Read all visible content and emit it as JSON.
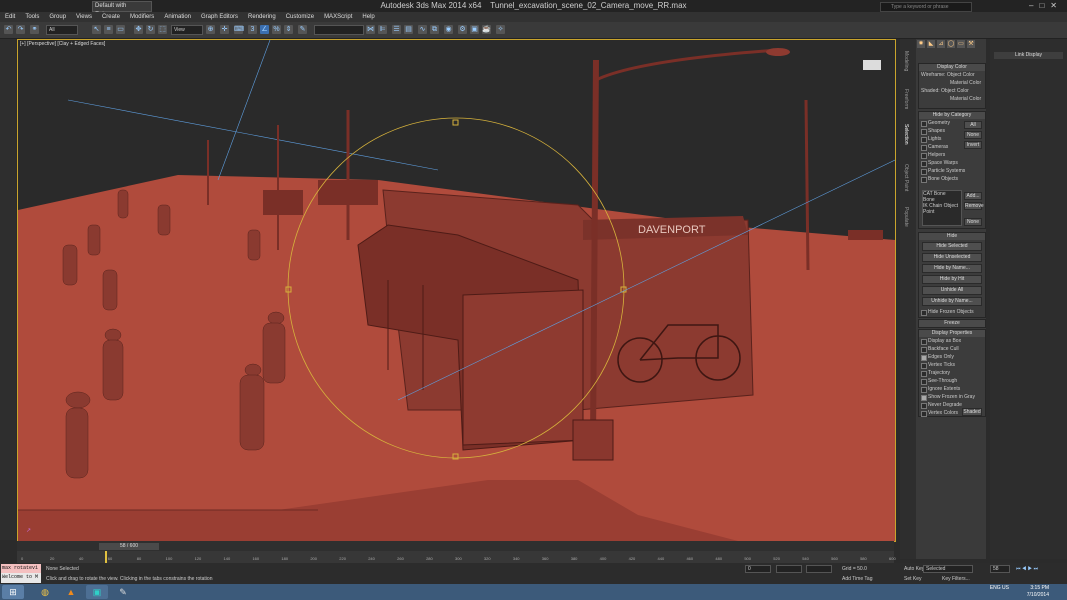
{
  "titlebar": {
    "app": "Autodesk 3ds Max  2014 x64",
    "file": "Tunnel_excavation_scene_02_Camera_move_RR.max",
    "workspace": "Default with Enhance",
    "search_placeholder": "Type a keyword or phrase"
  },
  "menu": [
    "Edit",
    "Tools",
    "Group",
    "Views",
    "Create",
    "Modifiers",
    "Animation",
    "Graph Editors",
    "Rendering",
    "Customize",
    "MAXScript",
    "Help"
  ],
  "toolbar": {
    "filter": "All",
    "refcoord": "View"
  },
  "viewport": {
    "label": "[+] [Perspective] [Clay + Edged Faces]",
    "sign": "DAVENPORT"
  },
  "cmdtabs": [
    "Modeling",
    "Freeform",
    "Selection",
    "Object Paint",
    "Populate"
  ],
  "cmdpanel": {
    "display_color": {
      "title": "Display Color",
      "wireframe_label": "Wireframe:",
      "shaded_label": "Shaded:",
      "object_color": "Object Color",
      "material_color": "Material Color"
    },
    "hide_by_category": {
      "title": "Hide by Category",
      "items": [
        "Geometry",
        "Shapes",
        "Lights",
        "Cameras",
        "Helpers",
        "Space Warps",
        "Particle Systems",
        "Bone Objects"
      ],
      "buttons": [
        "All",
        "None",
        "Invert"
      ],
      "list": [
        "CAT Bone",
        "Bone",
        "IK Chain Object",
        "Point"
      ],
      "list_buttons": [
        "Add...",
        "Remove",
        "None"
      ]
    },
    "hide": {
      "title": "Hide",
      "buttons": [
        "Hide Selected",
        "Hide Unselected",
        "Hide by Name...",
        "Hide by Hit",
        "Unhide All",
        "Unhide by Name..."
      ],
      "frozen": "Hide Frozen Objects"
    },
    "freeze": {
      "title": "Freeze"
    },
    "display_properties": {
      "title": "Display Properties",
      "items": [
        "Display as Box",
        "Backface Cull",
        "Edges Only",
        "Vertex Ticks",
        "Trajectory",
        "See-Through",
        "Ignore Extents",
        "Show Frozen in Gray",
        "Never Degrade",
        "Vertex Colors"
      ],
      "shaded": "Shaded"
    }
  },
  "linkpanel": {
    "title": "Link Display"
  },
  "timeline": {
    "frame": "58 / 600",
    "ticks": [
      "0",
      "20",
      "40",
      "60",
      "80",
      "100",
      "120",
      "140",
      "160",
      "180",
      "200",
      "220",
      "240",
      "260",
      "280",
      "300",
      "320",
      "340",
      "360",
      "380",
      "400",
      "420",
      "440",
      "460",
      "480",
      "500",
      "520",
      "540",
      "560",
      "580",
      "600"
    ]
  },
  "status": {
    "maxscript_line1": "max rotatevi",
    "maxscript_line2": "Welcome to M",
    "selection": "None Selected",
    "prompt": "Click and drag to rotate the view.  Clicking in the tabs constrains the rotation",
    "grid": "Grid = 50.0",
    "autokey": "Auto Key",
    "setkey": "Set Key",
    "selected": "Selected",
    "keyfilters": "Key Filters...",
    "addtimetag": "Add Time Tag",
    "x_val": "0",
    "frame_field": "58"
  },
  "taskbar": {
    "lang": "ENG\nUS",
    "time": "3:15 PM",
    "date": "7/10/2014"
  }
}
